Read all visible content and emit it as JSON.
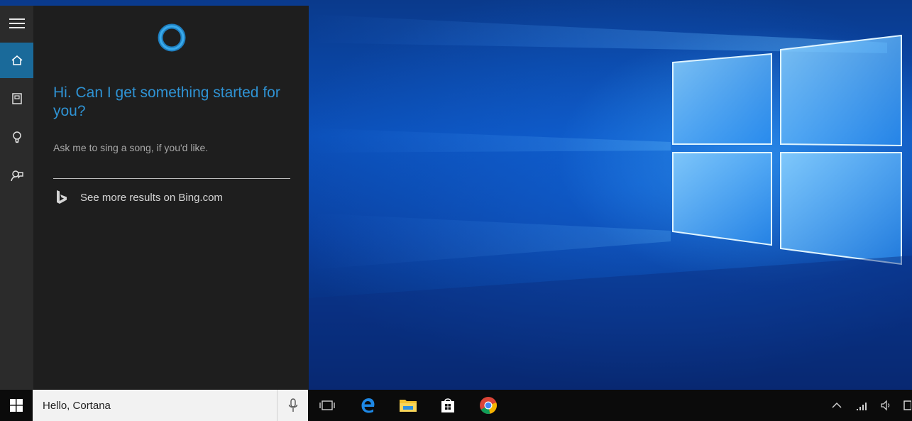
{
  "cortana": {
    "greeting": "Hi. Can I get something started for you?",
    "hint": "Ask me to sing a song, if you'd like.",
    "bing_link": "See more results on Bing.com",
    "accent_color": "#2f93d4",
    "rail": [
      {
        "icon": "hamburger-menu-icon"
      },
      {
        "icon": "home-icon",
        "active": true
      },
      {
        "icon": "notebook-icon"
      },
      {
        "icon": "lightbulb-icon"
      },
      {
        "icon": "feedback-icon"
      }
    ]
  },
  "taskbar": {
    "search_value": "Hello, Cortana",
    "pinned_apps": [
      "task-view-icon",
      "edge-icon",
      "file-explorer-icon",
      "store-icon",
      "chrome-icon"
    ],
    "tray_icons": [
      "chevron-up-icon",
      "wifi-icon",
      "volume-icon",
      "action-center-icon"
    ]
  }
}
